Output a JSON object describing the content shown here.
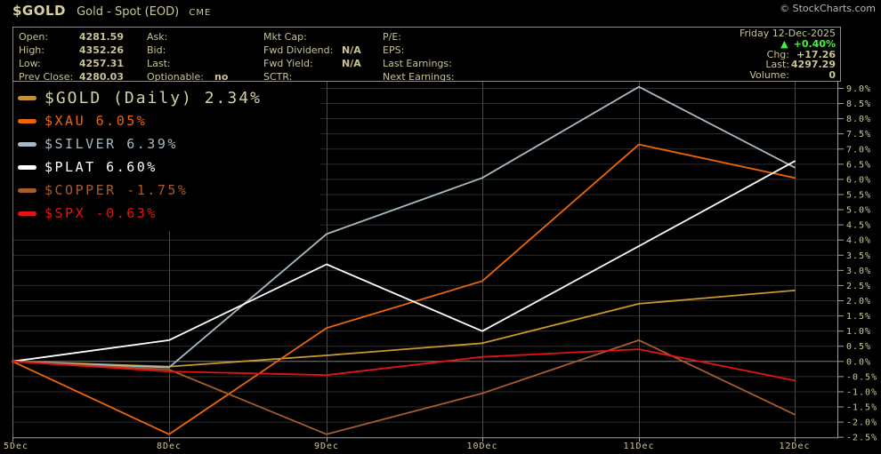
{
  "header": {
    "symbol": "$GOLD",
    "description": "Gold - Spot (EOD)",
    "exchange": "CME",
    "copyright": "© StockCharts.com"
  },
  "info_box": {
    "col1": [
      {
        "label": "Open:",
        "value": "4281.59"
      },
      {
        "label": "High:",
        "value": "4352.26"
      },
      {
        "label": "Low:",
        "value": "4257.31"
      },
      {
        "label": "Prev Close:",
        "value": "4280.03"
      }
    ],
    "col2": [
      {
        "label": "Ask:",
        "value": ""
      },
      {
        "label": "Bid:",
        "value": ""
      },
      {
        "label": "Last:",
        "value": ""
      },
      {
        "label": "Optionable:",
        "value": "no"
      }
    ],
    "col3": [
      {
        "label": "Mkt Cap:",
        "value": ""
      },
      {
        "label": "Fwd Dividend:",
        "value": "N/A"
      },
      {
        "label": "Fwd Yield:",
        "value": "N/A"
      },
      {
        "label": "SCTR:",
        "value": ""
      }
    ],
    "col4": [
      {
        "label": "P/E:",
        "value": ""
      },
      {
        "label": "EPS:",
        "value": ""
      },
      {
        "label": "Last Earnings:",
        "value": ""
      },
      {
        "label": "Next Earnings:",
        "value": ""
      }
    ],
    "right": {
      "date": "Friday 12-Dec-2025",
      "up_arrow": "▲",
      "pct_change": "+0.40%",
      "rows": [
        {
          "label": "Chg:",
          "value": "+17.26"
        },
        {
          "label": "Last:",
          "value": "4297.29"
        },
        {
          "label": "Volume:",
          "value": "0"
        }
      ]
    }
  },
  "legend": [
    {
      "label": "$GOLD (Daily) 2.34%",
      "text_color": "#d6d0a2",
      "swatch_color": "#c49232",
      "big": true
    },
    {
      "label": "$XAU 6.05%",
      "text_color": "#ec6608",
      "swatch_color": "#ec6608",
      "big": false
    },
    {
      "label": "$SILVER 6.39%",
      "text_color": "#a7b9c3",
      "swatch_color": "#a7b9c3",
      "big": false
    },
    {
      "label": "$PLAT 6.60%",
      "text_color": "#ffffff",
      "swatch_color": "#ffffff",
      "big": false
    },
    {
      "label": "$COPPER -1.75%",
      "text_color": "#a65c2b",
      "swatch_color": "#a65c2b",
      "big": false
    },
    {
      "label": "$SPX -0.63%",
      "text_color": "#e21414",
      "swatch_color": "#e21414",
      "big": false
    }
  ],
  "chart_data": {
    "type": "line",
    "x_labels": [
      "5Dec",
      "8Dec",
      "9Dec",
      "10Dec",
      "11Dec",
      "12Dec"
    ],
    "y_tick_labels": [
      "9.0%",
      "8.5%",
      "8.0%",
      "7.5%",
      "7.0%",
      "6.5%",
      "6.0%",
      "5.5%",
      "5.0%",
      "4.5%",
      "4.0%",
      "3.5%",
      "3.0%",
      "2.5%",
      "2.0%",
      "1.5%",
      "1.0%",
      "0.5%",
      "0.0%",
      "-0.5%",
      "-1.0%",
      "-1.5%",
      "-2.0%",
      "-2.5%"
    ],
    "y_tick_values": [
      9,
      8.5,
      8,
      7.5,
      7,
      6.5,
      6,
      5.5,
      5,
      4.5,
      4,
      3.5,
      3,
      2.5,
      2,
      1.5,
      1,
      0.5,
      0,
      -0.5,
      -1,
      -1.5,
      -2,
      -2.5
    ],
    "ylim": [
      -2.5,
      9.25
    ],
    "grid": true,
    "legend_position": "top-left",
    "series": [
      {
        "name": "$GOLD",
        "final_pct": 2.34,
        "color": "#c8992f",
        "values": [
          0,
          -0.17,
          0.2,
          0.6,
          1.9,
          2.34
        ]
      },
      {
        "name": "$XAU",
        "final_pct": 6.05,
        "color": "#ec6608",
        "values": [
          0,
          -2.4,
          1.1,
          2.65,
          7.15,
          6.05
        ]
      },
      {
        "name": "$SILVER",
        "final_pct": 6.39,
        "color": "#a7b9c3",
        "values": [
          0,
          -0.2,
          4.2,
          6.05,
          9.05,
          6.39
        ]
      },
      {
        "name": "$PLAT",
        "final_pct": 6.6,
        "color": "#ffffff",
        "values": [
          0,
          0.7,
          3.2,
          1.0,
          3.8,
          6.6
        ]
      },
      {
        "name": "$COPPER",
        "final_pct": -1.75,
        "color": "#a65c2b",
        "values": [
          0,
          -0.27,
          -2.4,
          -1.05,
          0.7,
          -1.75
        ]
      },
      {
        "name": "$SPX",
        "final_pct": -0.63,
        "color": "#e21414",
        "values": [
          0,
          -0.33,
          -0.45,
          0.15,
          0.4,
          -0.63
        ]
      }
    ]
  }
}
